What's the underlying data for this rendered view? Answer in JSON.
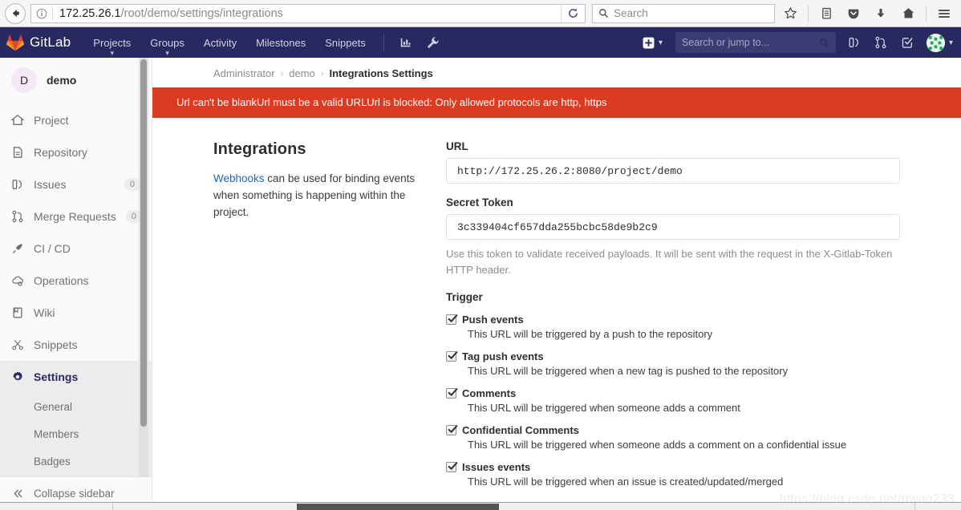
{
  "browser": {
    "back_tooltip": "Back",
    "identity_tooltip": "Site information",
    "url_host": "172.25.26.1",
    "url_path": "/root/demo/settings/integrations",
    "reload_tooltip": "Reload",
    "search_placeholder": "Search",
    "toolbar_icons": [
      "bookmark-star-icon",
      "library-icon",
      "pocket-icon",
      "downloads-icon",
      "home-icon",
      "hamburger-menu-icon"
    ]
  },
  "navbar": {
    "brand": "GitLab",
    "links": [
      {
        "label": "Projects",
        "has_caret": true
      },
      {
        "label": "Groups",
        "has_caret": true
      },
      {
        "label": "Activity",
        "has_caret": false
      },
      {
        "label": "Milestones",
        "has_caret": false
      },
      {
        "label": "Snippets",
        "has_caret": false
      }
    ],
    "icons": [
      "analytics-chart-icon",
      "admin-wrench-icon"
    ],
    "new_button": "plus-icon",
    "search_placeholder": "Search or jump to...",
    "right_icons": [
      "issues-icon",
      "merge-requests-icon",
      "todos-icon"
    ],
    "avatar": "user-avatar"
  },
  "sidebar": {
    "project_initial": "D",
    "project_name": "demo",
    "items": [
      {
        "label": "Project",
        "icon": "home-icon",
        "badge": ""
      },
      {
        "label": "Repository",
        "icon": "document-icon",
        "badge": ""
      },
      {
        "label": "Issues",
        "icon": "issues-icon",
        "badge": "0"
      },
      {
        "label": "Merge Requests",
        "icon": "merge-requests-icon",
        "badge": "0"
      },
      {
        "label": "CI / CD",
        "icon": "rocket-icon",
        "badge": ""
      },
      {
        "label": "Operations",
        "icon": "cloud-gear-icon",
        "badge": ""
      },
      {
        "label": "Wiki",
        "icon": "book-icon",
        "badge": ""
      },
      {
        "label": "Snippets",
        "icon": "scissors-icon",
        "badge": ""
      },
      {
        "label": "Settings",
        "icon": "gear-icon",
        "badge": "",
        "active": true
      }
    ],
    "subitems": [
      {
        "label": "General"
      },
      {
        "label": "Members"
      },
      {
        "label": "Badges"
      }
    ],
    "collapse_label": "Collapse sidebar"
  },
  "breadcrumb": {
    "items": [
      "Administrator",
      "demo"
    ],
    "current": "Integrations Settings",
    "separator": "›"
  },
  "alert": {
    "message": "Url can't be blankUrl must be a valid URLUrl is blocked: Only allowed protocols are http, https"
  },
  "main": {
    "heading": "Integrations",
    "description_link": "Webhooks",
    "description_rest": " can be used for binding events when something is happening within the project.",
    "url_label": "URL",
    "url_value": "http://172.25.26.2:8080/project/demo",
    "token_label": "Secret Token",
    "token_value": "3c339404cf657dda255bcbc58de9b2c9",
    "token_help": "Use this token to validate received payloads. It will be sent with the request in the X-Gitlab-Token HTTP header.",
    "trigger_label": "Trigger",
    "triggers": [
      {
        "label": "Push events",
        "desc": "This URL will be triggered by a push to the repository",
        "checked": true
      },
      {
        "label": "Tag push events",
        "desc": "This URL will be triggered when a new tag is pushed to the repository",
        "checked": true
      },
      {
        "label": "Comments",
        "desc": "This URL will be triggered when someone adds a comment",
        "checked": true
      },
      {
        "label": "Confidential Comments",
        "desc": "This URL will be triggered when someone adds a comment on a confidential issue",
        "checked": true
      },
      {
        "label": "Issues events",
        "desc": "This URL will be triggered when an issue is created/updated/merged",
        "checked": true
      }
    ]
  },
  "watermark": "https://blog.csdn.net/qwqq233",
  "colors": {
    "gitlab_navy": "#292961",
    "alert_red": "#db3b21",
    "link_blue": "#1b69b6",
    "active_sidebar_bg": "#ececef"
  }
}
